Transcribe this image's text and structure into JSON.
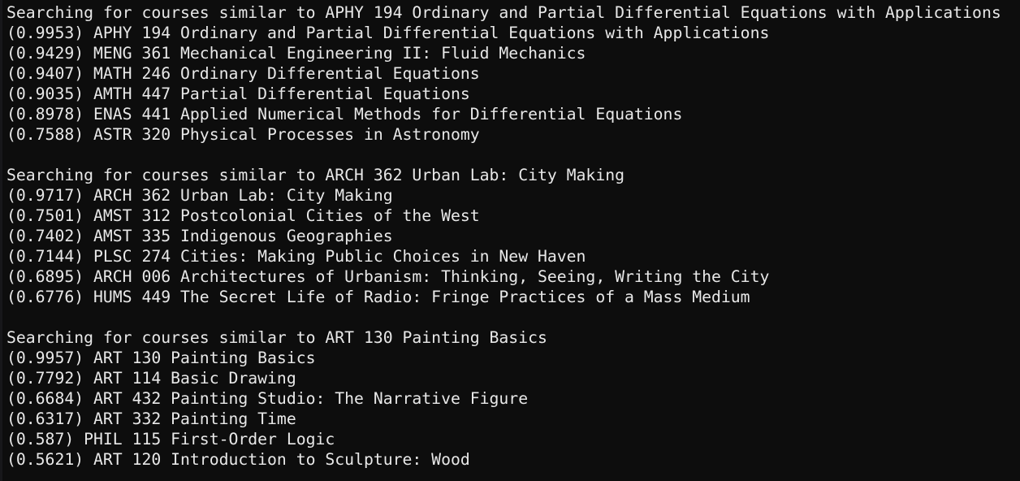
{
  "terminal": {
    "background_color": "#0d0d0d",
    "text_color": "#e8e8e8",
    "gutter_color": "#17171a"
  },
  "blocks": [
    {
      "query_line": "Searching for courses similar to APHY 194 Ordinary and Partial Differential Equations with Applications",
      "query_course": "APHY 194 Ordinary and Partial Differential Equations with Applications",
      "results": [
        {
          "line": "(0.9953) APHY 194 Ordinary and Partial Differential Equations with Applications",
          "score": "0.9953",
          "course": "APHY 194 Ordinary and Partial Differential Equations with Applications"
        },
        {
          "line": "(0.9429) MENG 361 Mechanical Engineering II: Fluid Mechanics",
          "score": "0.9429",
          "course": "MENG 361 Mechanical Engineering II: Fluid Mechanics"
        },
        {
          "line": "(0.9407) MATH 246 Ordinary Differential Equations",
          "score": "0.9407",
          "course": "MATH 246 Ordinary Differential Equations"
        },
        {
          "line": "(0.9035) AMTH 447 Partial Differential Equations",
          "score": "0.9035",
          "course": "AMTH 447 Partial Differential Equations"
        },
        {
          "line": "(0.8978) ENAS 441 Applied Numerical Methods for Differential Equations",
          "score": "0.8978",
          "course": "ENAS 441 Applied Numerical Methods for Differential Equations"
        },
        {
          "line": "(0.7588) ASTR 320 Physical Processes in Astronomy",
          "score": "0.7588",
          "course": "ASTR 320 Physical Processes in Astronomy"
        }
      ]
    },
    {
      "query_line": "Searching for courses similar to ARCH 362 Urban Lab: City Making",
      "query_course": "ARCH 362 Urban Lab: City Making",
      "results": [
        {
          "line": "(0.9717) ARCH 362 Urban Lab: City Making",
          "score": "0.9717",
          "course": "ARCH 362 Urban Lab: City Making"
        },
        {
          "line": "(0.7501) AMST 312 Postcolonial Cities of the West",
          "score": "0.7501",
          "course": "AMST 312 Postcolonial Cities of the West"
        },
        {
          "line": "(0.7402) AMST 335 Indigenous Geographies",
          "score": "0.7402",
          "course": "AMST 335 Indigenous Geographies"
        },
        {
          "line": "(0.7144) PLSC 274 Cities: Making Public Choices in New Haven",
          "score": "0.7144",
          "course": "PLSC 274 Cities: Making Public Choices in New Haven"
        },
        {
          "line": "(0.6895) ARCH 006 Architectures of Urbanism: Thinking, Seeing, Writing the City",
          "score": "0.6895",
          "course": "ARCH 006 Architectures of Urbanism: Thinking, Seeing, Writing the City"
        },
        {
          "line": "(0.6776) HUMS 449 The Secret Life of Radio: Fringe Practices of a Mass Medium",
          "score": "0.6776",
          "course": "HUMS 449 The Secret Life of Radio: Fringe Practices of a Mass Medium"
        }
      ]
    },
    {
      "query_line": "Searching for courses similar to ART 130 Painting Basics",
      "query_course": "ART 130 Painting Basics",
      "results": [
        {
          "line": "(0.9957) ART 130 Painting Basics",
          "score": "0.9957",
          "course": "ART 130 Painting Basics"
        },
        {
          "line": "(0.7792) ART 114 Basic Drawing",
          "score": "0.7792",
          "course": "ART 114 Basic Drawing"
        },
        {
          "line": "(0.6684) ART 432 Painting Studio: The Narrative Figure",
          "score": "0.6684",
          "course": "ART 432 Painting Studio: The Narrative Figure"
        },
        {
          "line": "(0.6317) ART 332 Painting Time",
          "score": "0.6317",
          "course": "ART 332 Painting Time"
        },
        {
          "line": "(0.587) PHIL 115 First-Order Logic",
          "score": "0.587",
          "course": "PHIL 115 First-Order Logic"
        },
        {
          "line": "(0.5621) ART 120 Introduction to Sculpture: Wood",
          "score": "0.5621",
          "course": "ART 120 Introduction to Sculpture: Wood"
        }
      ]
    }
  ],
  "lines": [
    "Searching for courses similar to APHY 194 Ordinary and Partial Differential Equations with Applications",
    "(0.9953) APHY 194 Ordinary and Partial Differential Equations with Applications",
    "(0.9429) MENG 361 Mechanical Engineering II: Fluid Mechanics",
    "(0.9407) MATH 246 Ordinary Differential Equations",
    "(0.9035) AMTH 447 Partial Differential Equations",
    "(0.8978) ENAS 441 Applied Numerical Methods for Differential Equations",
    "(0.7588) ASTR 320 Physical Processes in Astronomy",
    "",
    "Searching for courses similar to ARCH 362 Urban Lab: City Making",
    "(0.9717) ARCH 362 Urban Lab: City Making",
    "(0.7501) AMST 312 Postcolonial Cities of the West",
    "(0.7402) AMST 335 Indigenous Geographies",
    "(0.7144) PLSC 274 Cities: Making Public Choices in New Haven",
    "(0.6895) ARCH 006 Architectures of Urbanism: Thinking, Seeing, Writing the City",
    "(0.6776) HUMS 449 The Secret Life of Radio: Fringe Practices of a Mass Medium",
    "",
    "Searching for courses similar to ART 130 Painting Basics",
    "(0.9957) ART 130 Painting Basics",
    "(0.7792) ART 114 Basic Drawing",
    "(0.6684) ART 432 Painting Studio: The Narrative Figure",
    "(0.6317) ART 332 Painting Time",
    "(0.587) PHIL 115 First-Order Logic",
    "(0.5621) ART 120 Introduction to Sculpture: Wood"
  ]
}
